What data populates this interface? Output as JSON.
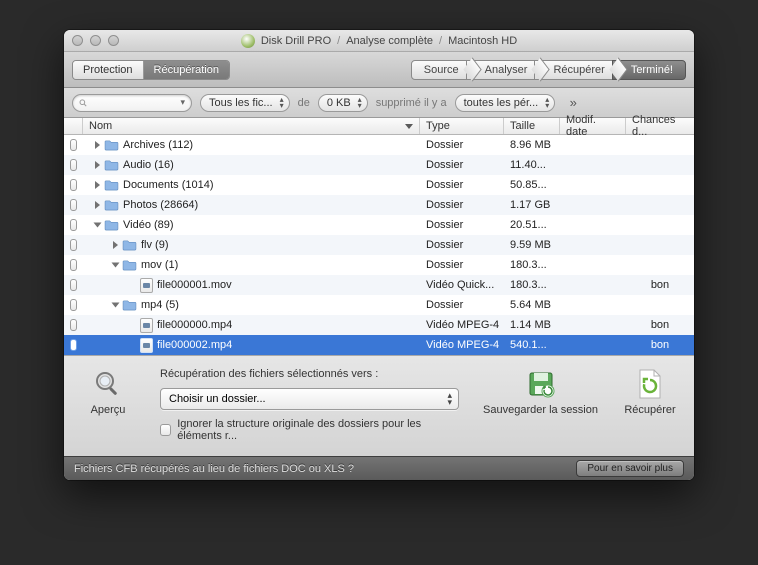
{
  "title": {
    "app": "Disk Drill PRO",
    "crumbs": [
      "Analyse complète",
      "Macintosh HD"
    ]
  },
  "tabs": {
    "protection": "Protection",
    "recovery": "Récupération"
  },
  "chevron": [
    "Source",
    "Analyser",
    "Récupérer",
    "Terminé!"
  ],
  "filter": {
    "all_files": "Tous les fic...",
    "de": "de",
    "size": "0 KB",
    "deleted": "supprimé il y a",
    "period": "toutes les pér..."
  },
  "columns": {
    "name": "Nom",
    "type": "Type",
    "size": "Taille",
    "date": "Modif. date",
    "chance": "Chances d..."
  },
  "rows": [
    {
      "depth": 0,
      "disc": "closed",
      "icon": "folder",
      "name": "Archives (112)",
      "type": "Dossier",
      "size": "8.96 MB",
      "date": "",
      "chance": ""
    },
    {
      "depth": 0,
      "disc": "closed",
      "icon": "folder",
      "name": "Audio (16)",
      "type": "Dossier",
      "size": "11.40...",
      "date": "",
      "chance": ""
    },
    {
      "depth": 0,
      "disc": "closed",
      "icon": "folder",
      "name": "Documents (1014)",
      "type": "Dossier",
      "size": "50.85...",
      "date": "",
      "chance": ""
    },
    {
      "depth": 0,
      "disc": "closed",
      "icon": "folder",
      "name": "Photos (28664)",
      "type": "Dossier",
      "size": "1.17 GB",
      "date": "",
      "chance": ""
    },
    {
      "depth": 0,
      "disc": "open",
      "icon": "folder",
      "name": "Vidéo (89)",
      "type": "Dossier",
      "size": "20.51...",
      "date": "",
      "chance": ""
    },
    {
      "depth": 1,
      "disc": "closed",
      "icon": "folder",
      "name": "flv (9)",
      "type": "Dossier",
      "size": "9.59 MB",
      "date": "",
      "chance": ""
    },
    {
      "depth": 1,
      "disc": "open",
      "icon": "folder",
      "name": "mov (1)",
      "type": "Dossier",
      "size": "180.3...",
      "date": "",
      "chance": ""
    },
    {
      "depth": 2,
      "disc": "none",
      "icon": "file",
      "name": "file000001.mov",
      "type": "Vidéo Quick...",
      "size": "180.3...",
      "date": "",
      "chance": "bon"
    },
    {
      "depth": 1,
      "disc": "open",
      "icon": "folder",
      "name": "mp4 (5)",
      "type": "Dossier",
      "size": "5.64 MB",
      "date": "",
      "chance": ""
    },
    {
      "depth": 2,
      "disc": "none",
      "icon": "file",
      "name": "file000000.mp4",
      "type": "Vidéo MPEG-4",
      "size": "1.14 MB",
      "date": "",
      "chance": "bon"
    },
    {
      "depth": 2,
      "disc": "none",
      "icon": "file",
      "name": "file000002.mp4",
      "type": "Vidéo MPEG-4",
      "size": "540.1...",
      "date": "",
      "chance": "bon",
      "selected": true
    }
  ],
  "bottom": {
    "preview": "Aperçu",
    "label": "Récupération des fichiers sélectionnés vers :",
    "choose": "Choisir un dossier...",
    "ignore": "Ignorer la structure originale des dossiers pour les éléments r...",
    "save_session": "Sauvegarder la session",
    "recover": "Récupérer"
  },
  "footer": {
    "msg": "Fichiers CFB récupérés au lieu de fichiers DOC ou XLS ?",
    "more": "Pour en savoir plus"
  }
}
